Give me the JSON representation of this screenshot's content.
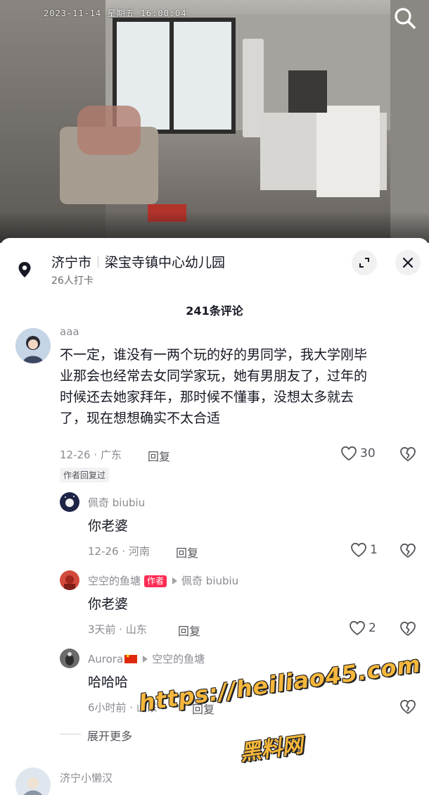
{
  "video": {
    "timestamp": "2023-11-14 星期五 16:00:04",
    "search_icon": "search-icon"
  },
  "location": {
    "city": "济宁市",
    "place": "梁宝寺镇中心幼儿园",
    "checkins": "26人打卡",
    "pin_icon": "location-pin-icon",
    "expand_icon": "expand-icon",
    "close_icon": "close-icon"
  },
  "comment_count": "241条评论",
  "comments": [
    {
      "user": "aaa",
      "text_lines": [
        "不一定，谁没有一两个玩的好的男同学，我大学刚毕",
        "业那会也经常去女同学家玩，她有男朋友了，过年的",
        "时候还去她家拜年，那时候不懂事，没想太多就去",
        "了，现在想想确实不太合适"
      ],
      "meta": "12-26 · 广东",
      "reply_label": "回复",
      "likes": "30",
      "author_replied_tag": "作者回复过"
    }
  ],
  "replies": [
    {
      "user": "佩奇 biubiu",
      "text": "你老婆",
      "meta": "12-26 · 河南",
      "reply_label": "回复",
      "likes": "1"
    },
    {
      "user": "空空的鱼塘",
      "badge": "作者",
      "reply_to": "佩奇 biubiu",
      "text": "你老婆",
      "meta": "3天前 · 山东",
      "reply_label": "回复",
      "likes": "2"
    },
    {
      "user": "Aurora",
      "reply_to": "空空的鱼塘",
      "text": "哈哈哈",
      "meta": "6小时前 · 山东",
      "reply_label": "回复"
    }
  ],
  "expand_more": "展开更多",
  "next_comment": {
    "user": "济宁小懒汉"
  },
  "watermark": {
    "url": "https://heiliao45.com",
    "name": "黑料网"
  },
  "colors": {
    "accent": "#fe2c55",
    "text_primary": "#161823",
    "text_secondary": "#8a8b91",
    "watermark": "#f6b73c"
  }
}
